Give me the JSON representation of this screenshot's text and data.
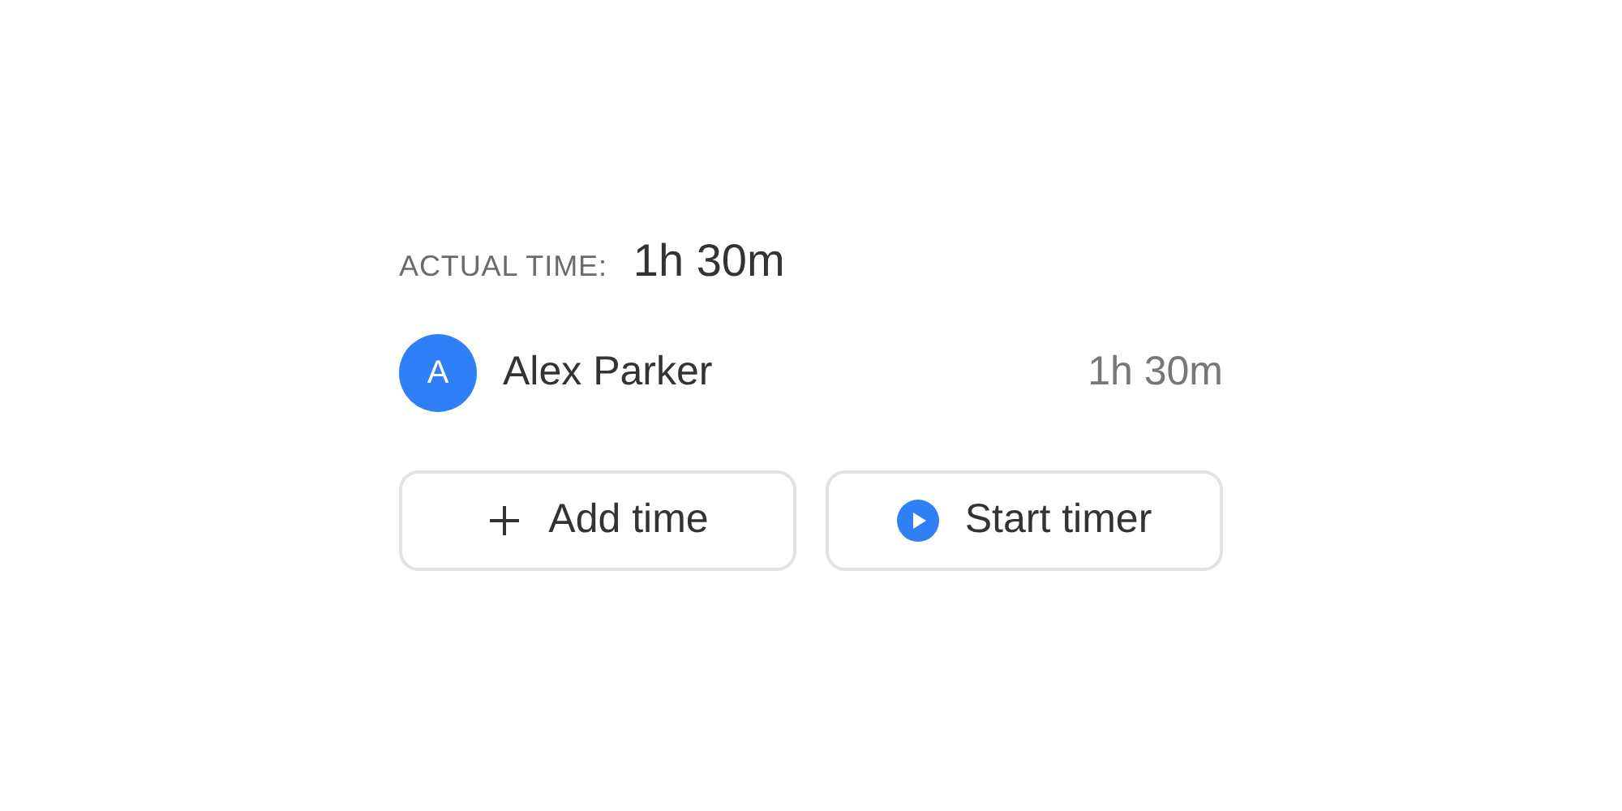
{
  "actual_time": {
    "label": "ACTUAL TIME:",
    "value": "1h 30m"
  },
  "entries": [
    {
      "initial": "A",
      "name": "Alex Parker",
      "time": "1h 30m",
      "color": "#2f80f7"
    }
  ],
  "buttons": [
    {
      "kind": "add",
      "label": "Add time"
    },
    {
      "kind": "timer",
      "label": "Start timer"
    }
  ]
}
